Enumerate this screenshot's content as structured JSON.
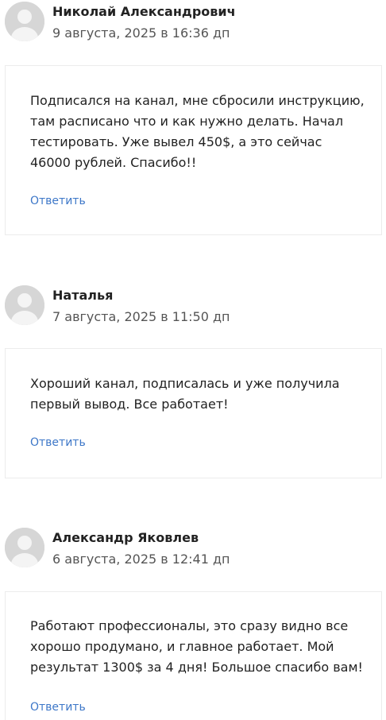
{
  "comments": [
    {
      "author": "Николай Александрович",
      "date": "9 августа, 2025 в 16:36 дп",
      "text": "Подписался на канал, мне сбросили инструкцию, там расписано что и как нужно делать. Начал тестировать. Уже вывел 450$, а это сейчас 46000 рублей. Спасибо!!",
      "reply_label": "Ответить"
    },
    {
      "author": "Наталья",
      "date": "7 августа, 2025 в 11:50 дп",
      "text": "Хороший канал, подписалась и уже получила первый вывод. Все работает!",
      "reply_label": "Ответить"
    },
    {
      "author": "Александр Яковлев",
      "date": "6 августа, 2025 в 12:41 дп",
      "text": "Работают профессионалы, это сразу видно все хорошо продумано, и главное работает. Мой результат 1300$ за 4 дня! Большое спасибо вам!",
      "reply_label": "Ответить"
    }
  ],
  "icons": {
    "avatar": "user-avatar-placeholder-icon"
  },
  "colors": {
    "link": "#3d77c8",
    "avatar_bg": "#d6d6d6",
    "avatar_fg": "#f4f4f4",
    "box_border": "#ececec"
  }
}
